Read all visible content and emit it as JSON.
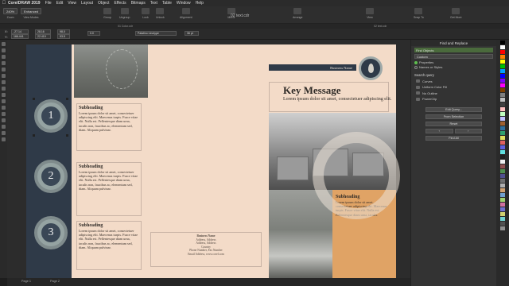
{
  "menubar": {
    "app_name": "CorelDRAW 2019",
    "items": [
      "File",
      "Edit",
      "View",
      "Layout",
      "Object",
      "Effects",
      "Bitmaps",
      "Text",
      "Table",
      "Window",
      "Help"
    ]
  },
  "toolbar": {
    "zoom_value": "240%",
    "zoom_label": "Zoom",
    "view_mode_value": "Enhanced",
    "view_mode_label": "View Modes",
    "buttons": [
      "Group",
      "Ungroup",
      "Lock",
      "Unlock",
      "Alignment",
      "Mirror",
      "Arrange",
      "View",
      "Snap To",
      "Get More"
    ],
    "doc_title": "02 text.cdr"
  },
  "tabs": {
    "left_tab": "01 Color.cdr",
    "right_tab": "02 text.cdr"
  },
  "propbar": {
    "x": "-27.14",
    "y": "166.441",
    "w": "28.16",
    "h": "22.419",
    "sx": "98.0",
    "sy": "93.5",
    "angle": "0.0",
    "font": "Palatino Linotype",
    "size": "36 pt"
  },
  "page": {
    "subheadings": [
      {
        "number": "1",
        "title": "Subheading",
        "body": "Lorem ipsum dolor sit amet, consectetuer adipiscing elit. Maecenas turpis. Fusce vitae elit. Nulla est. Pellentesque diam urna, iaculis non, faucibus ac, elementum sed, diam. Aliquam pulvinar."
      },
      {
        "number": "2",
        "title": "Subheading",
        "body": "Lorem ipsum dolor sit amet, consectetuer adipiscing elit. Maecenas turpis. Fusce vitae elit. Nulla est. Pellentesque diam urna, iaculis non, faucibus ac, elementum sed, diam. Aliquam pulvinar."
      },
      {
        "number": "3",
        "title": "Subheading",
        "body": "Lorem ipsum dolor sit amet, consectetuer adipiscing elit. Maecenas turpis. Fusce vitae elit. Nulla est. Pellentesque diam urna, iaculis non, faucibus ac, elementum sed, diam. Aliquam pulvinar."
      }
    ],
    "contact": {
      "name": "Business Name",
      "line1": "Address, Address",
      "line2": "Address, Address",
      "line3": "Country",
      "line4": "Phone Number, Fax Number",
      "line5": "Email Address, www.corel.com"
    },
    "business_name": "Business Name",
    "key_message": "Key Message",
    "key_sub": "Lorem ipsum dolor sit amet, consectetuer adipiscing elit.",
    "orange_block": {
      "title": "Subheading",
      "body": "Lorem ipsum dolor sit amet, consectetuer adipiscing elit. Maecenas turpis. Fusce vitae elit. Nulla est. Pellentesque diam urna, iaculis."
    }
  },
  "bottombar": {
    "page1": "Page 1",
    "page2": "Page 2"
  },
  "docker": {
    "title": "Find and Replace",
    "mode": "Find Objects",
    "preset": "Custom",
    "radio_properties": "Properties",
    "radio_names": "Names or Styles",
    "search_query_label": "Search query",
    "query_items": [
      "Curves",
      "Uniform Color Fill",
      "No Outline",
      "PowerClip"
    ],
    "btn_edit_query": "Edit Query...",
    "btn_from_selection": "From Selection",
    "btn_reset": "Reset",
    "btn_find_all": "Find All"
  },
  "palette_colors": [
    "#000000",
    "#ffffff",
    "#ff0000",
    "#ff8000",
    "#ffff00",
    "#00c000",
    "#00a0ff",
    "#0000ff",
    "#8000ff",
    "#ff00ff",
    "#804000",
    "#808080",
    "#c0c0c0",
    "#404040",
    "#ffc0c0",
    "#c0ffc0",
    "#c0c0ff",
    "#a06030",
    "#3070a0",
    "#30a070",
    "#e0e060",
    "#e06060",
    "#6060e0",
    "#60e0e0",
    "#202020",
    "#f0f0f0",
    "#905050",
    "#509050",
    "#505090",
    "#707070",
    "#b0b0b0",
    "#d0a070",
    "#70a0d0",
    "#a0d070",
    "#d070a0",
    "#7070d0",
    "#d0d070",
    "#70d0d0",
    "#505050",
    "#909090"
  ]
}
